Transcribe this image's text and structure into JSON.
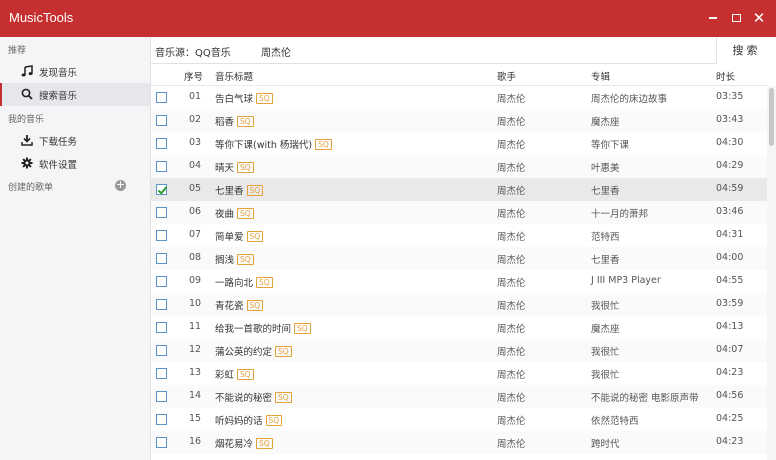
{
  "app": {
    "title": "MusicTools"
  },
  "sidebar": {
    "group_recommend": "推荐",
    "item_discover": "发现音乐",
    "item_search": "搜索音乐",
    "group_my_music": "我的音乐",
    "item_download": "下载任务",
    "item_settings": "软件设置",
    "group_playlists": "创建的歌单",
    "add_symbol": "+"
  },
  "search": {
    "source_label": "音乐源：QQ音乐",
    "query": "周杰伦",
    "button_label": "搜索"
  },
  "table": {
    "headers": {
      "no": "序号",
      "title": "音乐标题",
      "artist": "歌手",
      "album": "专辑",
      "duration": "时长"
    },
    "quality_badge": "SQ",
    "rows": [
      {
        "no": "01",
        "title": "告白气球",
        "artist": "周杰伦",
        "album": "周杰伦的床边故事",
        "duration": "03:35",
        "checked": false
      },
      {
        "no": "02",
        "title": "稻香",
        "artist": "周杰伦",
        "album": "魔杰座",
        "duration": "03:43",
        "checked": false
      },
      {
        "no": "03",
        "title": "等你下课(with 杨瑞代)",
        "artist": "周杰伦",
        "album": "等你下课",
        "duration": "04:30",
        "checked": false
      },
      {
        "no": "04",
        "title": "晴天",
        "artist": "周杰伦",
        "album": "叶惠美",
        "duration": "04:29",
        "checked": false
      },
      {
        "no": "05",
        "title": "七里香",
        "artist": "周杰伦",
        "album": "七里香",
        "duration": "04:59",
        "checked": true
      },
      {
        "no": "06",
        "title": "夜曲",
        "artist": "周杰伦",
        "album": "十一月的萧邦",
        "duration": "03:46",
        "checked": false
      },
      {
        "no": "07",
        "title": "简单爱",
        "artist": "周杰伦",
        "album": "范特西",
        "duration": "04:31",
        "checked": false
      },
      {
        "no": "08",
        "title": "搁浅",
        "artist": "周杰伦",
        "album": "七里香",
        "duration": "04:00",
        "checked": false
      },
      {
        "no": "09",
        "title": "一路向北",
        "artist": "周杰伦",
        "album": "J III MP3 Player",
        "duration": "04:55",
        "checked": false
      },
      {
        "no": "10",
        "title": "青花瓷",
        "artist": "周杰伦",
        "album": "我很忙",
        "duration": "03:59",
        "checked": false
      },
      {
        "no": "11",
        "title": "给我一首歌的时间",
        "artist": "周杰伦",
        "album": "魔杰座",
        "duration": "04:13",
        "checked": false
      },
      {
        "no": "12",
        "title": "蒲公英的约定",
        "artist": "周杰伦",
        "album": "我很忙",
        "duration": "04:07",
        "checked": false
      },
      {
        "no": "13",
        "title": "彩虹",
        "artist": "周杰伦",
        "album": "我很忙",
        "duration": "04:23",
        "checked": false
      },
      {
        "no": "14",
        "title": "不能说的秘密",
        "artist": "周杰伦",
        "album": "不能说的秘密 电影原声带",
        "duration": "04:56",
        "checked": false
      },
      {
        "no": "15",
        "title": "听妈妈的话",
        "artist": "周杰伦",
        "album": "依然范特西",
        "duration": "04:25",
        "checked": false
      },
      {
        "no": "16",
        "title": "烟花易冷",
        "artist": "周杰伦",
        "album": "跨时代",
        "duration": "04:23",
        "checked": false
      }
    ]
  },
  "colors": {
    "accent": "#c62f2f",
    "badge": "#e5a23a",
    "checkbox_border": "#5a93c9",
    "check_mark": "#2f9b2f"
  }
}
